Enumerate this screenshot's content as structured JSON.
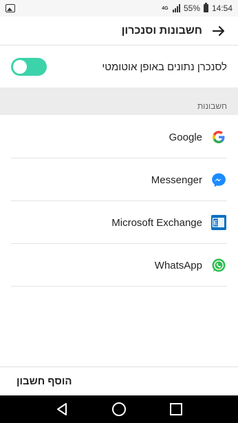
{
  "status_bar": {
    "network": "4G",
    "battery_percent": "55%",
    "time": "14:54",
    "icons": [
      "gallery-icon",
      "network-4g-icon",
      "signal-icon",
      "battery-icon"
    ]
  },
  "header": {
    "title": "חשבונות וסנכרון",
    "back_icon": "arrow-right-icon"
  },
  "sync": {
    "label": "לסנכרן נתונים באופן אוטומטי",
    "toggle_on": true,
    "toggle_color": "#3dd3aa"
  },
  "section": {
    "title": "חשבונות"
  },
  "accounts": [
    {
      "name": "Google",
      "icon": "google-icon"
    },
    {
      "name": "Messenger",
      "icon": "messenger-icon"
    },
    {
      "name": "Microsoft Exchange",
      "icon": "exchange-icon"
    },
    {
      "name": "WhatsApp",
      "icon": "whatsapp-icon"
    }
  ],
  "footer": {
    "add_account_label": "הוסף חשבון"
  },
  "nav": {
    "icons": [
      "back-triangle-icon",
      "home-circle-icon",
      "recents-square-icon"
    ]
  }
}
